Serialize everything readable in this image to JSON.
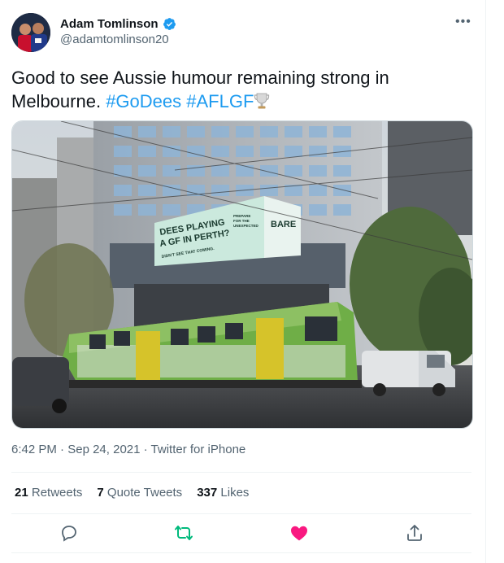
{
  "author": {
    "name": "Adam Tomlinson",
    "handle": "@adamtomlinson20",
    "verified": true
  },
  "tweet": {
    "text_before": "Good to see Aussie humour remaining strong in Melbourne. ",
    "hashtags": [
      "#GoDees",
      "#AFLGF"
    ],
    "emoji": "trophy"
  },
  "media": {
    "billboard": {
      "headline_line1": "DEES PLAYING",
      "headline_line2": "A GF IN PERTH?",
      "subline": "DIDN'T SEE THAT COMING.",
      "prepare_line1": "PREPARE",
      "prepare_line2": "FOR THE",
      "prepare_line3": "UNEXPECTED",
      "brand": "BARE"
    }
  },
  "meta": {
    "time": "6:42 PM",
    "date": "Sep 24, 2021",
    "source": "Twitter for iPhone"
  },
  "stats": {
    "retweets_count": "21",
    "retweets_label": "Retweets",
    "quotes_count": "7",
    "quotes_label": "Quote Tweets",
    "likes_count": "337",
    "likes_label": "Likes"
  },
  "colors": {
    "link": "#1d9bf0",
    "retweet_green": "#00ba7c",
    "like_pink": "#f91880",
    "muted": "#536471"
  }
}
